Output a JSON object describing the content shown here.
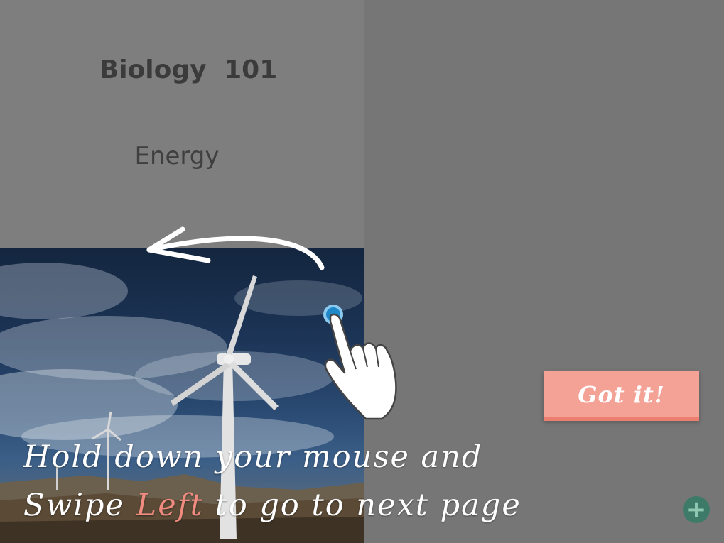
{
  "card": {
    "title": "Biology 101",
    "subtitle": "Energy"
  },
  "tutorial": {
    "instruction_line1": "Hold down your mouse and",
    "instruction_line2_prefix": "Swipe ",
    "instruction_line2_accent": "Left",
    "instruction_line2_suffix": " to go to next page",
    "got_it_label": "Got it!"
  },
  "fab": {
    "add_symbol": "+"
  },
  "icons": {
    "swipe": "swipe-left-arrow-icon",
    "hand": "pointing-hand-icon",
    "add": "plus-icon"
  },
  "colors": {
    "accent": "#f08b80",
    "button": "#f4a196",
    "fab": "#3e7a68"
  }
}
